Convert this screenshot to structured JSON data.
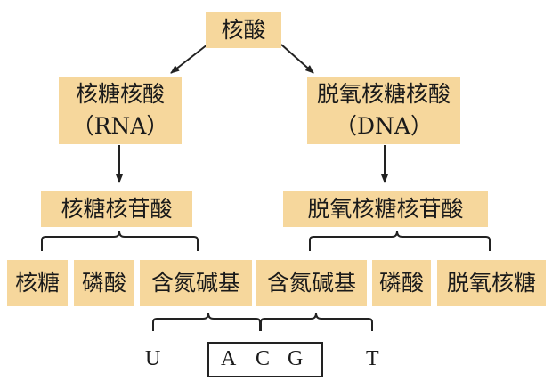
{
  "nodes": {
    "root": "核酸",
    "rna_name": "核糖核酸",
    "rna_abbr": "（RNA）",
    "dna_name": "脱氧核糖核酸",
    "dna_abbr": "（DNA）",
    "rna_nucleotide": "核糖核苷酸",
    "dna_nucleotide": "脱氧核糖核苷酸",
    "rna_sugar": "核糖",
    "rna_phosphate": "磷酸",
    "rna_base": "含氮碱基",
    "dna_base": "含氮碱基",
    "dna_phosphate": "磷酸",
    "dna_sugar": "脱氧核糖"
  },
  "bases": {
    "u": "U",
    "a": "A",
    "c": "C",
    "g": "G",
    "t": "T"
  },
  "colors": {
    "box_fill": "#f6d79c",
    "line": "#222222"
  }
}
